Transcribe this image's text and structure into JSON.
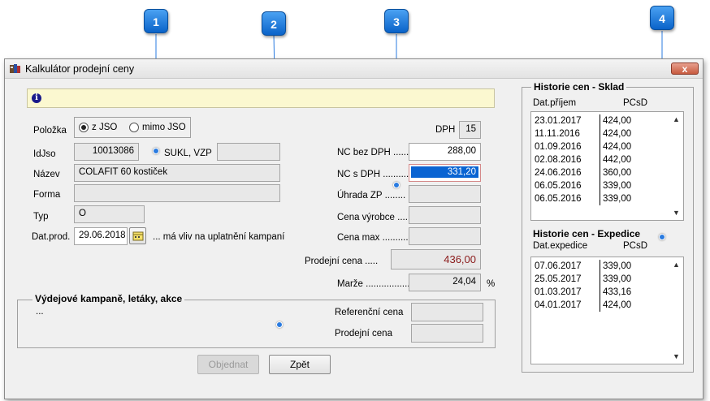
{
  "window": {
    "title": "Kalkulátor prodejní ceny",
    "close_label": "x"
  },
  "info": {
    "icon": "info-icon",
    "text": ""
  },
  "left": {
    "polozka_label": "Položka",
    "radio_z_jso": "z JSO",
    "radio_mimo_jso": "mimo JSO",
    "radio_selected": "z JSO",
    "idjso_label": "IdJso",
    "idjso_value": "10013086",
    "sukl_label": "SUKL, VZP",
    "sukl_value": "",
    "nazev_label": "Název",
    "nazev_value": "COLAFIT 60 kostiček",
    "forma_label": "Forma",
    "forma_value": "",
    "typ_label": "Typ",
    "typ_value": "O",
    "datprod_label": "Dat.prod.",
    "datprod_value": "29.06.2018",
    "datprod_note": "... má vliv na uplatnění kampaní"
  },
  "middle": {
    "dph_label": "DPH",
    "dph_value": "15",
    "nc_bez_dph_label": "NC bez DPH ......",
    "nc_bez_dph_value": "288,00",
    "nc_s_dph_label": "NC s DPH ...........",
    "nc_s_dph_value": "331,20",
    "uhrada_label": "Úhrada ZP ........",
    "uhrada_value": "",
    "cena_vyrobce_label": "Cena výrobce ....",
    "cena_vyrobce_value": "",
    "cena_max_label": "Cena max ..........",
    "cena_max_value": "",
    "prodejni_cena_label": "Prodejní cena .....",
    "prodejni_cena_value": "436,00",
    "marze_label": "Marže ..................",
    "marze_value": "24,04",
    "marze_unit": "%"
  },
  "campaigns": {
    "title": "Výdejové kampaně, letáky, akce",
    "text": "...",
    "ref_cena_label": "Referenční cena",
    "ref_cena_value": "",
    "prodejni_cena_label": "Prodejní cena",
    "prodejni_cena_value": ""
  },
  "buttons": {
    "objednat": "Objednat",
    "zpet": "Zpět"
  },
  "history_sklad": {
    "title": "Historie cen - Sklad",
    "col_date": "Dat.příjem",
    "col_price": "PCsD",
    "rows": [
      {
        "date": "23.01.2017",
        "price": "424,00"
      },
      {
        "date": "11.11.2016",
        "price": "424,00"
      },
      {
        "date": "01.09.2016",
        "price": "424,00"
      },
      {
        "date": "02.08.2016",
        "price": "442,00"
      },
      {
        "date": "24.06.2016",
        "price": "360,00"
      },
      {
        "date": "06.05.2016",
        "price": "339,00"
      },
      {
        "date": "06.05.2016",
        "price": "339,00"
      }
    ]
  },
  "history_expedice": {
    "title": "Historie cen - Expedice",
    "col_date": "Dat.expedice",
    "col_price": "PCsD",
    "rows": [
      {
        "date": "07.06.2017",
        "price": "339,00"
      },
      {
        "date": "25.05.2017",
        "price": "339,00"
      },
      {
        "date": "01.03.2017",
        "price": "433,16"
      },
      {
        "date": "04.01.2017",
        "price": "424,00"
      }
    ]
  },
  "callouts": [
    "1",
    "2",
    "3",
    "4"
  ],
  "colors": {
    "callout": "#1a78e0",
    "selection": "#0a64d2",
    "prodejni_cena_text": "#8b1a1a",
    "info_bar": "#fbf8d0"
  }
}
